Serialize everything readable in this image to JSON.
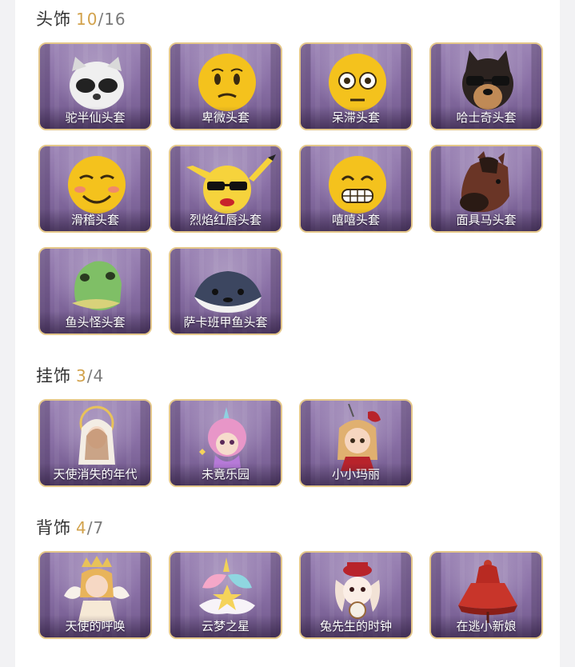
{
  "sections": [
    {
      "title": "头饰",
      "owned": "10",
      "total": "/16",
      "items": [
        {
          "label": "驼半仙头套",
          "icon": "raccoon-mask-icon"
        },
        {
          "label": "卑微头套",
          "icon": "humble-face-mask-icon"
        },
        {
          "label": "呆滞头套",
          "icon": "dazed-face-mask-icon"
        },
        {
          "label": "哈士奇头套",
          "icon": "husky-mask-icon"
        },
        {
          "label": "滑稽头套",
          "icon": "funny-face-mask-icon"
        },
        {
          "label": "烈焰红唇头套",
          "icon": "pikachu-mask-icon"
        },
        {
          "label": "嘻嘻头套",
          "icon": "grin-face-mask-icon"
        },
        {
          "label": "面具马头套",
          "icon": "horse-mask-icon"
        },
        {
          "label": "鱼头怪头套",
          "icon": "fish-head-mask-icon"
        },
        {
          "label": "萨卡班甲鱼头套",
          "icon": "sacabambaspis-mask-icon"
        }
      ]
    },
    {
      "title": "挂饰",
      "owned": "3",
      "total": "/4",
      "items": [
        {
          "label": "天使消失的年代",
          "icon": "angel-pendant-icon"
        },
        {
          "label": "未竟乐园",
          "icon": "unicorn-girl-pendant-icon"
        },
        {
          "label": "小小玛丽",
          "icon": "little-mary-pendant-icon"
        }
      ]
    },
    {
      "title": "背饰",
      "owned": "4",
      "total": "/7",
      "items": [
        {
          "label": "天使的呼唤",
          "icon": "angel-back-icon"
        },
        {
          "label": "云梦之星",
          "icon": "unicorn-star-back-icon"
        },
        {
          "label": "兔先生的时钟",
          "icon": "rabbit-clock-back-icon"
        },
        {
          "label": "在逃小新娘",
          "icon": "bride-dress-back-icon"
        }
      ]
    }
  ],
  "colors": {
    "owned_count": "#d2a24c",
    "card_border": "#e4c78a",
    "card_bg": "#8a70a6"
  }
}
